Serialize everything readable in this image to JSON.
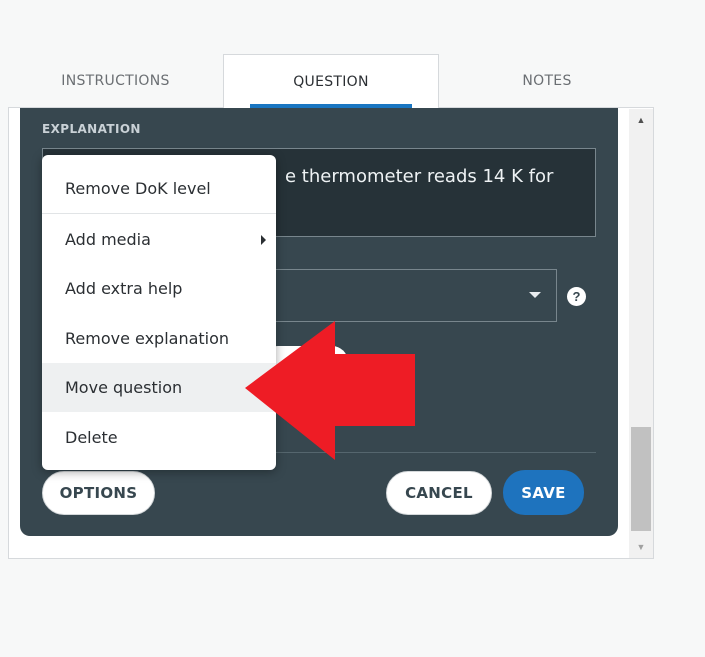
{
  "tabs": {
    "instructions": "INSTRUCTIONS",
    "question": "QUESTION",
    "notes": "NOTES"
  },
  "editor": {
    "explanation_label": "EXPLANATION",
    "explanation_visible_text": "e thermometer reads 14 K for",
    "help_icon_glyph": "?"
  },
  "menu": {
    "items": [
      "Remove DoK level",
      "Add media",
      "Add extra help",
      "Remove explanation",
      "Move question",
      "Delete"
    ],
    "hovered_item": "Move question"
  },
  "buttons": {
    "options": "OPTIONS",
    "cancel": "CANCEL",
    "save": "SAVE"
  },
  "colors": {
    "card_bg": "#37474f",
    "accent_blue": "#1e73be",
    "annotation_arrow": "#ee1c25"
  },
  "icons": {
    "scroll_up": "triangle-up",
    "scroll_down": "triangle-down",
    "dropdown": "chevron-down",
    "help": "question-circle",
    "submenu": "caret-right",
    "annotation": "red-left-arrow"
  }
}
